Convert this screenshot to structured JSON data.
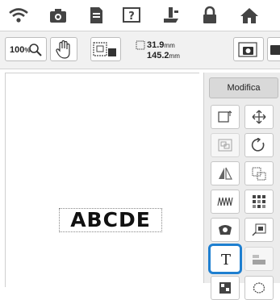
{
  "toolbar": {
    "zoom_label": "100",
    "zoom_unit": "%",
    "width_value": "31.9",
    "height_value": "145.2",
    "unit": "mm"
  },
  "icons": {
    "wifi": "wifi-icon",
    "camera": "camera-icon",
    "document": "document-icon",
    "help": "help-icon",
    "presser_foot": "presser-foot-icon",
    "lock": "lock-icon",
    "home": "home-icon"
  },
  "canvas": {
    "sample_text": "ABCDE"
  },
  "panel": {
    "tab_label": "Modifica",
    "buttons": [
      "size",
      "move",
      "group",
      "rotate",
      "mirror",
      "spacing",
      "density",
      "color-sort",
      "applique",
      "embroidery-order",
      "text-edit",
      "border",
      "shuffle",
      "outline"
    ],
    "text_edit_glyph": "T"
  },
  "colors": {
    "highlight": "#1e7fd0",
    "panel_bg": "#ececec",
    "toolbar_bg": "#f1f1f1"
  }
}
